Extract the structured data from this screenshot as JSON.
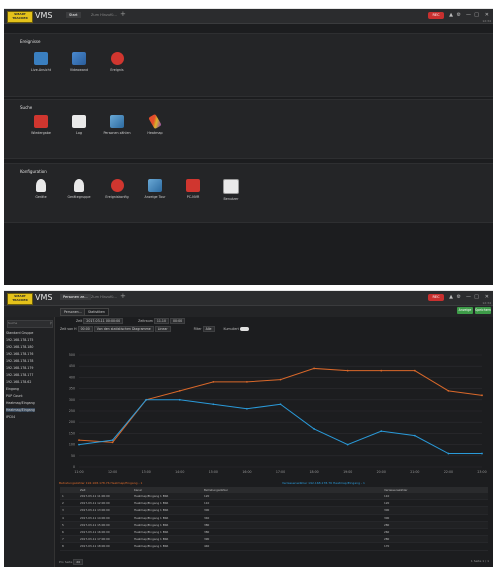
{
  "top": {
    "logo_text": [
      "SMART",
      "TRACKER"
    ],
    "app_title": "VMS",
    "tabs": [
      {
        "label": "Start"
      },
      {
        "label": "Zum Hinzufü..."
      }
    ],
    "rec_label": "REC",
    "time_label": "12:34",
    "sections": [
      {
        "title": "Ereignisse",
        "tiles": [
          {
            "label": "Live-Ansicht",
            "icon": "camera-icon",
            "color": "blue"
          },
          {
            "label": "Videowand",
            "icon": "video-wall-icon",
            "color": "bluemix"
          },
          {
            "label": "Ereignis",
            "icon": "alarm-icon",
            "color": "red"
          }
        ]
      },
      {
        "title": "Suche",
        "tiles": [
          {
            "label": "Wiedergabe",
            "icon": "playback-icon",
            "color": "redsq"
          },
          {
            "label": "Log",
            "icon": "log-book-icon",
            "color": "white"
          },
          {
            "label": "Personen zählen",
            "icon": "people-count-icon",
            "color": "teal"
          },
          {
            "label": "Heatmap",
            "icon": "heatmap-icon",
            "color": "pencil"
          }
        ]
      },
      {
        "title": "Konfiguration",
        "tiles": [
          {
            "label": "Geräte",
            "icon": "device-icon",
            "color": "person"
          },
          {
            "label": "Gerätegruppe",
            "icon": "device-group-icon",
            "color": "person"
          },
          {
            "label": "Ereigniskonfig",
            "icon": "event-config-icon",
            "color": "red"
          },
          {
            "label": "Anzeige Tour",
            "icon": "tour-icon",
            "color": "teal"
          },
          {
            "label": "PC-NVR",
            "icon": "pc-nvr-icon",
            "color": "redsq"
          },
          {
            "label": "Benutzer",
            "icon": "user-icon",
            "color": "badge"
          }
        ]
      }
    ]
  },
  "bottom": {
    "app_title": "VMS",
    "tabs": [
      {
        "label": "Personen ze..."
      },
      {
        "label": "Zum Hinzufü..."
      }
    ],
    "subtabs": [
      "Personen...",
      "Statistiken"
    ],
    "export_label": "Anzeige",
    "save_label": "Speichern",
    "search_placeholder": "Suche",
    "tree": [
      "Standard Gruppe",
      "192.168.178.175",
      "192.168.178.180",
      "192.168.178.176",
      "192.168.178.178",
      "192.168.178.179",
      "192.168.178.177",
      "192.168.178.62",
      "Eingang",
      "PUP Count",
      "Heatmap/Eingang",
      "Heatmap/Eingang",
      "IPC04"
    ],
    "filters": {
      "zeit_label": "Zeit",
      "zeit_value": "2017-03-11 00:00:00",
      "zeit_to_label": "Zeitraum",
      "zeit_to_value": "11.10",
      "zeit_to_end": "00:00",
      "row2_label": "Zeit von H",
      "row2_value": "00:00",
      "row2_mid": "Von den statistischen Diagramme",
      "row2_sel": "Linear",
      "filter_label": "Filter",
      "filter_value": "Alle",
      "kumul_label": "Kumuliert"
    },
    "legend": [
      "Betretungszähler 192.168.178.76 Heatmap/Eingang - 1",
      "Verlassenszähler 192.168.178.76 Heatmap/Eingang - 1"
    ],
    "table_headers": [
      "",
      "Zeit",
      "Kanal",
      "Betretungszähler",
      "Verlassenszähler"
    ],
    "table_rows": [
      [
        "1",
        "2017-03-11 11:00:00",
        "Heatmap/Eingang 1 BSR",
        "120",
        "110"
      ],
      [
        "2",
        "2017-03-11 12:00:00",
        "Heatmap/Eingang 1 BSR",
        "110",
        "120"
      ],
      [
        "3",
        "2017-03-11 13:00:00",
        "Heatmap/Eingang 1 BSR",
        "300",
        "300"
      ],
      [
        "4",
        "2017-03-11 14:00:00",
        "Heatmap/Eingang 1 BSR",
        "340",
        "300"
      ],
      [
        "5",
        "2017-03-11 15:00:00",
        "Heatmap/Eingang 1 BSR",
        "380",
        "280"
      ],
      [
        "6",
        "2017-03-11 16:00:00",
        "Heatmap/Eingang 1 BSR",
        "380",
        "260"
      ],
      [
        "7",
        "2017-03-11 17:00:00",
        "Heatmap/Eingang 1 BSR",
        "390",
        "280"
      ],
      [
        "8",
        "2017-03-11 18:00:00",
        "Heatmap/Eingang 1 BSR",
        "440",
        "170"
      ]
    ],
    "footer_label": "Pro Seite",
    "footer_value": "20",
    "pager_label": "1  Seite 1  / 1"
  },
  "chart_data": {
    "type": "line",
    "categories": [
      "11:00",
      "12:00",
      "13:00",
      "14:00",
      "15:00",
      "16:00",
      "17:00",
      "18:00",
      "19:00",
      "20:00",
      "21:00",
      "22:00",
      "23:00"
    ],
    "yticks": [
      0,
      50,
      100,
      150,
      200,
      250,
      300,
      350,
      400,
      450,
      500
    ],
    "ylim": [
      0,
      500
    ],
    "series": [
      {
        "name": "Betretungszähler 192.168.178.76 Heatmap/Eingang - 1",
        "color": "#d9682a",
        "values": [
          120,
          110,
          300,
          340,
          380,
          380,
          390,
          440,
          430,
          430,
          430,
          340,
          320
        ]
      },
      {
        "name": "Verlassenszähler 192.168.178.76 Heatmap/Eingang - 1",
        "color": "#2a9ad9",
        "values": [
          100,
          120,
          300,
          300,
          280,
          260,
          280,
          170,
          100,
          160,
          140,
          60,
          60
        ]
      }
    ],
    "grid": true,
    "legend_position": "bottom"
  },
  "colors": {
    "accent": "#3d9b48",
    "record": "#c8302f"
  }
}
